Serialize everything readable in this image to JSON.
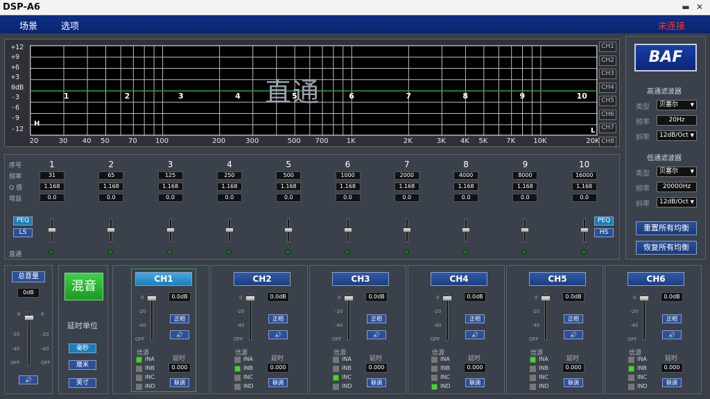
{
  "window": {
    "title": "DSP-A6",
    "minimize": "▬",
    "close": "✕"
  },
  "menu": {
    "scene": "场景",
    "options": "选项",
    "status": "未连接"
  },
  "graph": {
    "mode_text": "直通",
    "y_ticks": [
      "+12",
      "+9",
      "+6",
      "+3",
      "0dB",
      "-3",
      "-6",
      "-9",
      "-12"
    ],
    "x_ticks": [
      "20",
      "30",
      "40",
      "50",
      "70",
      "100",
      "200",
      "300",
      "500",
      "700",
      "1K",
      "2K",
      "3K",
      "4K",
      "5K",
      "7K",
      "10K",
      "20K"
    ],
    "band_markers": [
      "1",
      "2",
      "3",
      "4",
      "5",
      "6",
      "7",
      "8",
      "9",
      "10"
    ],
    "low_marker": "H",
    "high_marker": "L",
    "ch_tags": [
      "CH1",
      "CH2",
      "CH3",
      "CH4",
      "CH5",
      "CH6",
      "CH7",
      "CH8"
    ]
  },
  "brand": {
    "logo_text": "BAF"
  },
  "highpass": {
    "title": "高通滤波器",
    "type_label": "类型",
    "type_value": "贝塞尔",
    "freq_label": "频率",
    "freq_value": "20Hz",
    "slope_label": "斜率",
    "slope_value": "12dB/Oct"
  },
  "lowpass": {
    "title": "低通滤波器",
    "type_label": "类型",
    "type_value": "贝塞尔",
    "freq_label": "频率",
    "freq_value": "20000Hz",
    "slope_label": "斜率",
    "slope_value": "12dB/Oct"
  },
  "actions": {
    "reset_all": "重置所有均衡",
    "restore_all": "恢复所有均衡"
  },
  "eq": {
    "row_labels": {
      "index": "序号",
      "freq": "频率",
      "q": "Q 值",
      "gain": "增益",
      "bypass": "直通"
    },
    "left_types": {
      "peq": "PEQ",
      "ls": "LS"
    },
    "right_types": {
      "peq": "PEQ",
      "hs": "HS"
    },
    "bands": [
      {
        "num": "1",
        "freq": "31",
        "q": "1.168",
        "gain": "0.0"
      },
      {
        "num": "2",
        "freq": "65",
        "q": "1.168",
        "gain": "0.0"
      },
      {
        "num": "3",
        "freq": "125",
        "q": "1.168",
        "gain": "0.0"
      },
      {
        "num": "4",
        "freq": "250",
        "q": "1.168",
        "gain": "0.0"
      },
      {
        "num": "5",
        "freq": "500",
        "q": "1.168",
        "gain": "0.0"
      },
      {
        "num": "6",
        "freq": "1000",
        "q": "1.168",
        "gain": "0.0"
      },
      {
        "num": "7",
        "freq": "2000",
        "q": "1.168",
        "gain": "0.0"
      },
      {
        "num": "8",
        "freq": "4000",
        "q": "1.168",
        "gain": "0.0"
      },
      {
        "num": "9",
        "freq": "8000",
        "q": "1.168",
        "gain": "0.0"
      },
      {
        "num": "10",
        "freq": "16000",
        "q": "1.168",
        "gain": "0.0"
      }
    ]
  },
  "master": {
    "title": "总音量",
    "value": "0dB",
    "scale": [
      "6",
      "-20",
      "-40",
      "OFF"
    ],
    "mute": "🔊"
  },
  "mix": {
    "label": "混音",
    "delay_unit_label": "延时单位",
    "units": [
      "毫秒",
      "厘米",
      "英寸"
    ]
  },
  "channel_common": {
    "phase": "正相",
    "mute": "🔊",
    "source_label": "信源",
    "delay_label": "延时",
    "link": "联调",
    "sources": [
      "INA",
      "INB",
      "INC",
      "IND"
    ],
    "scale": [
      "0",
      "-20",
      "-40",
      "OFF"
    ]
  },
  "channels": [
    {
      "name": "CH1",
      "level": "0.0dB",
      "delay": "0.000",
      "src": "INA"
    },
    {
      "name": "CH2",
      "level": "0.0dB",
      "delay": "0.000",
      "src": "INB"
    },
    {
      "name": "CH3",
      "level": "0.0dB",
      "delay": "0.000",
      "src": "INC"
    },
    {
      "name": "CH4",
      "level": "0.0dB",
      "delay": "0.000",
      "src": "IND"
    },
    {
      "name": "CH5",
      "level": "0.0dB",
      "delay": "0.000",
      "src": "INA"
    },
    {
      "name": "CH6",
      "level": "0.0dB",
      "delay": "0.000",
      "src": "INB"
    }
  ],
  "colors": {
    "menu_bg": "#0a2570",
    "status": "#ff3030",
    "response_line": "#2ea54a",
    "active_button": "#1a7fb9",
    "led": "#1d6a25"
  }
}
